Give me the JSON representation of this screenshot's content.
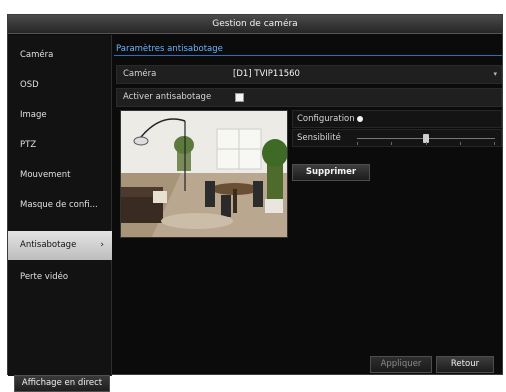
{
  "window": {
    "title": "Gestion de caméra"
  },
  "sidebar": {
    "items": [
      {
        "label": "Caméra"
      },
      {
        "label": "OSD"
      },
      {
        "label": "Image"
      },
      {
        "label": "PTZ"
      },
      {
        "label": "Mouvement"
      },
      {
        "label": "Masque de confi..."
      },
      {
        "label": "Antisabotage",
        "active": true,
        "chevron": "›"
      },
      {
        "label": "Perte vidéo"
      }
    ],
    "live_view_label": "Affichage en direct"
  },
  "tabs": [
    {
      "label": "Paramètres antisabotage"
    }
  ],
  "form": {
    "camera_label": "Caméra",
    "camera_value": "[D1] TVIP11560",
    "enable_label": "Activer antisabotage",
    "enable_checked": true,
    "configuration_label": "Configuration",
    "sensitivity_label": "Sensibilité",
    "sensitivity_level": 0.5
  },
  "buttons": {
    "delete_label": "Supprimer",
    "apply_label": "Appliquer",
    "back_label": "Retour"
  },
  "colors": {
    "accent": "#2f6fb8",
    "tab_text": "#6fb3ff",
    "active_item": "#d4d4d4"
  },
  "icons": {
    "dropdown": "chevron-down-icon",
    "configuration": "radio-dot-icon"
  }
}
